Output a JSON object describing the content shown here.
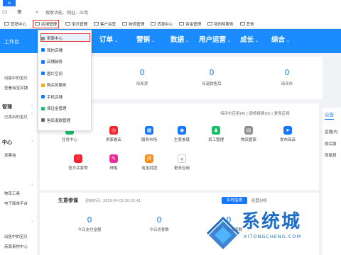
{
  "top": {
    "home_symbol": "⌂",
    "search_placeholder": "搜索功能、网址、应用"
  },
  "bookmarks": [
    {
      "label": "营销中心",
      "active": false
    },
    {
      "label": "店铺管理",
      "active": true
    },
    {
      "label": "宝贝管理",
      "active": false
    },
    {
      "label": "客户运营",
      "active": false
    },
    {
      "label": "物流管理",
      "active": false
    },
    {
      "label": "货源中心",
      "active": false
    },
    {
      "label": "资金管理",
      "active": false
    },
    {
      "label": "我的阿服务",
      "active": false
    },
    {
      "label": "其他",
      "active": false
    }
  ],
  "nav": {
    "workbench": "工作台",
    "items": [
      "订单",
      "营销",
      "数据",
      "用户运营",
      "成长",
      "综合"
    ],
    "caret": "⌄"
  },
  "dropdown": {
    "items": [
      {
        "label": "卖家中心",
        "icon": "seller-center-icon",
        "color": "#8e8e8e",
        "selected": true
      },
      {
        "label": "我的店铺",
        "icon": "my-store-icon",
        "color": "#1677ff",
        "selected": false
      },
      {
        "label": "店铺装修",
        "icon": "decoration-icon",
        "color": "#1677ff",
        "selected": false
      },
      {
        "label": "图片空间",
        "icon": "image-space-icon",
        "color": "#1677ff",
        "selected": false
      },
      {
        "label": "购买的服务",
        "icon": "services-icon",
        "color": "#f5a623",
        "selected": false
      },
      {
        "label": "手机店铺",
        "icon": "mobile-store-icon",
        "color": "#1677ff",
        "selected": false
      },
      {
        "label": "保证金管理",
        "icon": "deposit-icon",
        "color": "#19be6b",
        "selected": false
      },
      {
        "label": "售后退款管理",
        "icon": "refund-icon",
        "color": "#666666",
        "selected": false
      }
    ]
  },
  "sidebar": {
    "sections": [
      {
        "head": "",
        "items": [
          "出售中的宝贝",
          "查看淘宝店铺"
        ]
      },
      {
        "head": "管理",
        "items": [
          "已卖出的宝贝"
        ]
      },
      {
        "head": "中心",
        "items": [
          "发票淘"
        ]
      },
      {
        "head": "",
        "items": [
          "物流工具",
          "电子面单平台"
        ]
      },
      {
        "head": "",
        "items": [
          "出售中的宝贝",
          "商家素材中心"
        ]
      }
    ],
    "chev": "›"
  },
  "stats": [
    {
      "value": "0",
      "label": "待发货"
    },
    {
      "value": "0",
      "label": "待退款售后"
    },
    {
      "value": "0",
      "label": "待评价"
    }
  ],
  "apps_bar": {
    "text": "待评价应用(4) | 即将续费(0) | 更多应用",
    "announce": "公告",
    "ann_items": [
      "直播|内",
      "购后服",
      "商家超"
    ]
  },
  "apps": [
    {
      "label": "任务中心",
      "color": "#19be6b",
      "glyph": "✓"
    },
    {
      "label": "卖家看店",
      "color": "#f5222d",
      "glyph": "◎"
    },
    {
      "label": "服务市场",
      "color": "#1677ff",
      "glyph": "▦"
    },
    {
      "label": "生意参谋",
      "color": "#1677ff",
      "glyph": "◉"
    },
    {
      "label": "员工管理",
      "color": "#19be6b",
      "glyph": "♟"
    },
    {
      "label": "物流管家",
      "color": "#8e8e8e",
      "glyph": "▤"
    },
    {
      "label": "发布商品",
      "color": "#1677ff",
      "glyph": "➤"
    },
    {
      "label": "官方买家秀",
      "color": "#f5222d",
      "glyph": "♡"
    },
    {
      "label": "神笔",
      "color": "#eb2f96",
      "glyph": "✎"
    },
    {
      "label": "淘宝拼团",
      "color": "#fa8c16",
      "glyph": "拼"
    },
    {
      "label": "更多应用",
      "color": "#ffffff",
      "glyph": "+"
    }
  ],
  "business": {
    "title": "生意参谋",
    "updated": "更新时间：2019-04-03 20:02:41",
    "tab_realtime": "实时监测",
    "tab_analysis": "经营分析",
    "metrics": [
      {
        "value": "0",
        "label": "今日支付金额"
      },
      {
        "value": "0",
        "label": "今日访客数"
      },
      {
        "value": "0",
        "label": "今日支付买家数"
      }
    ]
  },
  "watermark": {
    "text": "系统城",
    "sub": "XITONGCHENG.COM"
  }
}
